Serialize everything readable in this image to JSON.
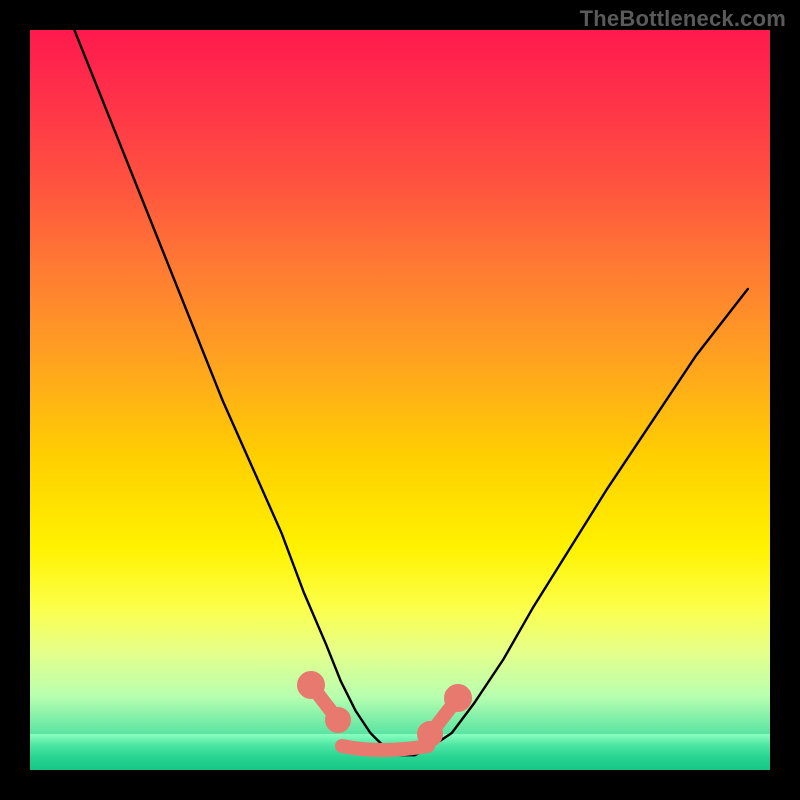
{
  "watermark": "TheBottleneck.com",
  "colors": {
    "curve_stroke": "#000000",
    "blob": "#e8796e",
    "frame": "#000000"
  },
  "chart_data": {
    "type": "line",
    "title": "",
    "xlabel": "",
    "ylabel": "",
    "xlim": [
      0,
      100
    ],
    "ylim": [
      0,
      100
    ],
    "grid": false,
    "legend": false,
    "series": [
      {
        "name": "bottleneck-curve",
        "x": [
          6,
          10,
          14,
          18,
          22,
          26,
          30,
          34,
          37,
          40,
          42,
          44,
          46,
          48,
          50,
          52,
          54,
          57,
          60,
          64,
          68,
          73,
          78,
          84,
          90,
          97
        ],
        "y": [
          100,
          90,
          80,
          70,
          60,
          50,
          41,
          32,
          24,
          17,
          12,
          8,
          5,
          3,
          2,
          2,
          3,
          5,
          9,
          15,
          22,
          30,
          38,
          47,
          56,
          65
        ]
      }
    ],
    "annotations": [
      {
        "name": "valley-marker-left",
        "x0": 38,
        "x1": 42,
        "y0": 12,
        "y1": 8
      },
      {
        "name": "valley-marker-center",
        "x0": 42,
        "x1": 54,
        "y0": 3,
        "y1": 3
      },
      {
        "name": "valley-marker-right",
        "x0": 54,
        "x1": 58,
        "y0": 5,
        "y1": 10
      }
    ],
    "background_gradient": {
      "type": "vertical",
      "stops": [
        {
          "pos": 0.0,
          "color": "#ff1a4d"
        },
        {
          "pos": 0.2,
          "color": "#ff5040"
        },
        {
          "pos": 0.44,
          "color": "#ffa021"
        },
        {
          "pos": 0.7,
          "color": "#fff200"
        },
        {
          "pos": 0.9,
          "color": "#b8ffb0"
        },
        {
          "pos": 1.0,
          "color": "#1fd08a"
        }
      ]
    }
  }
}
